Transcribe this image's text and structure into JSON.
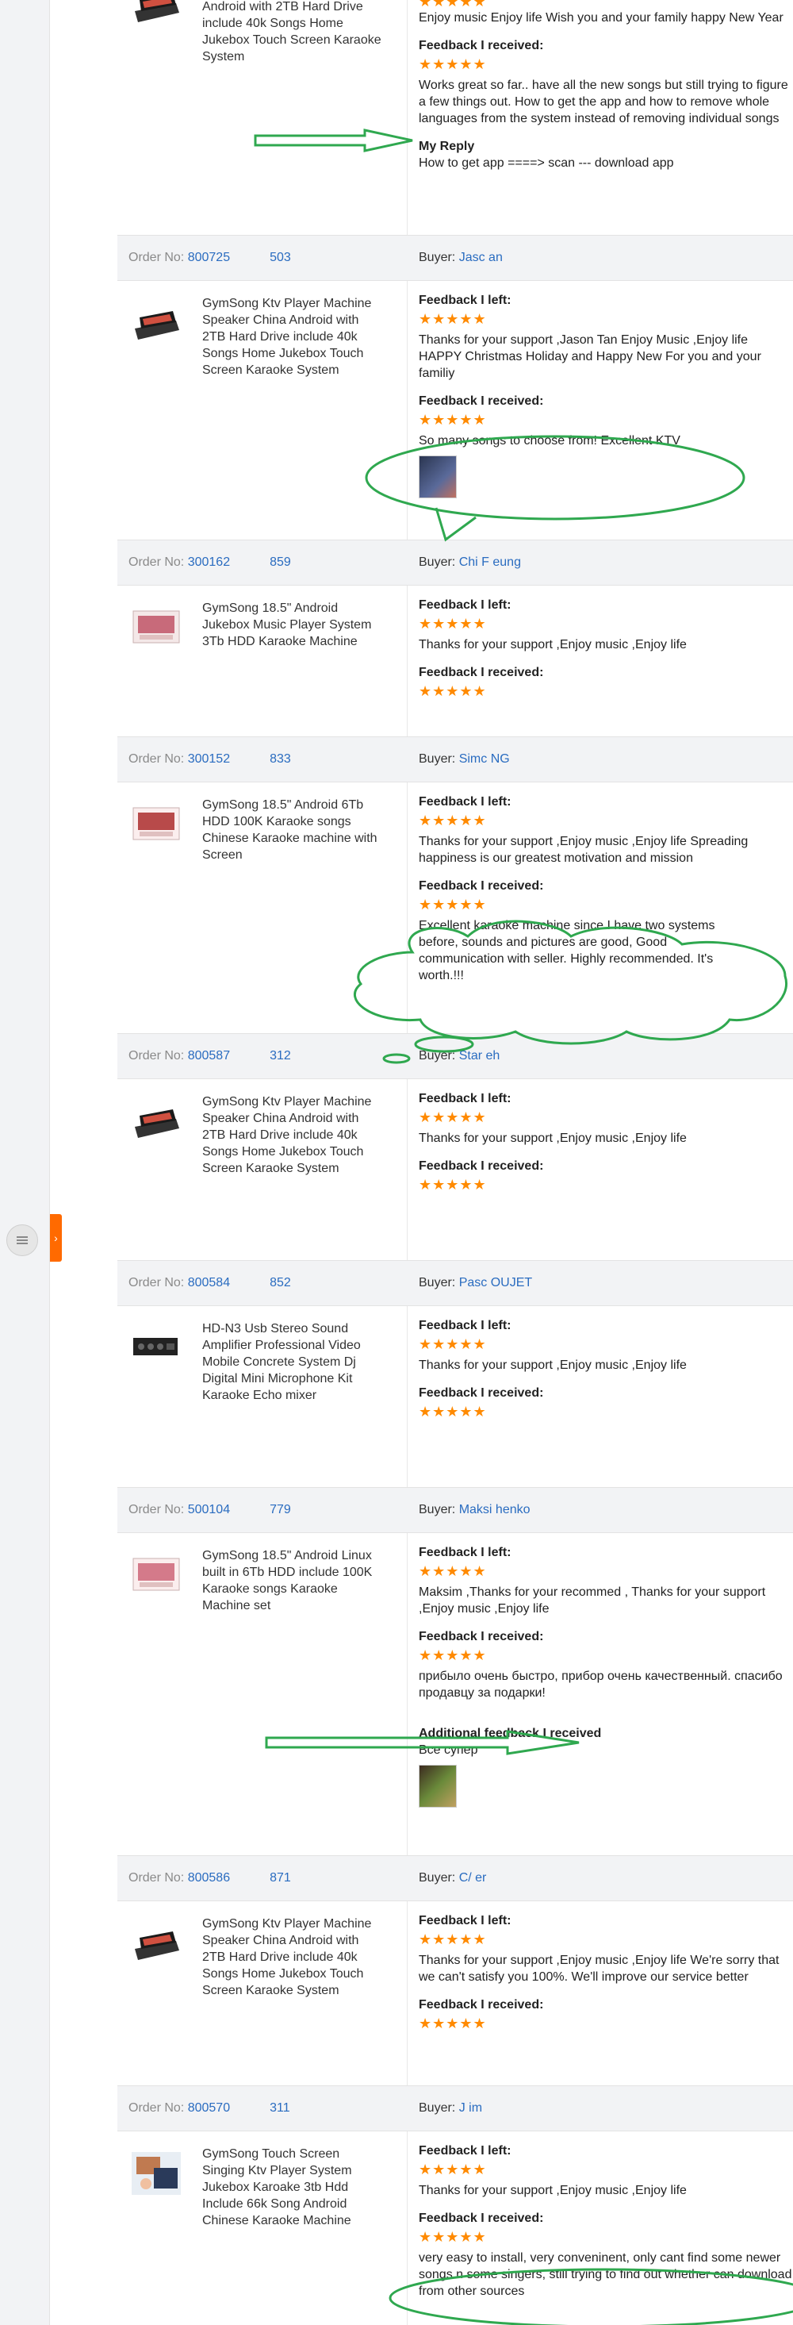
{
  "sidebar": {
    "menu_icon": "list-icon",
    "tab_icon": "chevron-right-icon",
    "tab_glyph": "›"
  },
  "top_partial": {
    "product_title": "Android with 2TB Hard Drive include 40k Songs Home Jukebox Touch Screen Karaoke System",
    "left_text": "Enjoy music Enjoy life Wish you and your family happy New Year",
    "received_label": "Feedback I received:",
    "received_text": "Works great so far.. have all the new songs but still trying to figure a few things out. How to get the app and how to remove whole languages from the system instead of removing individual songs",
    "reply_label": "My Reply",
    "reply_text": "How to get app ====> scan --- download app"
  },
  "labels": {
    "order_no": "Order No:",
    "buyer": "Buyer:",
    "left": "Feedback I left:",
    "received": "Feedback I received:",
    "additional": "Additional feedback I received"
  },
  "stars": "★★★★★",
  "orders": [
    {
      "order_no_a": "800725",
      "order_no_b": "503",
      "buyer": "Jasc        an",
      "product": "GymSong Ktv Player Machine Speaker China Android with 2TB Hard Drive include 40k Songs Home Jukebox Touch Screen Karaoke System",
      "left_text": "Thanks for your support ,Jason Tan Enjoy Music ,Enjoy life HAPPY Christmas Holiday and Happy New For you and your familiy",
      "received_text": "So many songs to choose from! Excellent KTV"
    },
    {
      "order_no_a": "300162",
      "order_no_b": "859",
      "buyer": "Chi F        eung",
      "product": "GymSong 18.5\" Android Jukebox Music Player System 3Tb HDD Karaoke Machine",
      "left_text": "Thanks for your support ,Enjoy music ,Enjoy life",
      "received_text": ""
    },
    {
      "order_no_a": "300152",
      "order_no_b": "833",
      "buyer": "Simc        NG",
      "product": "GymSong 18.5\" Android 6Tb HDD 100K Karaoke songs Chinese Karaoke machine with Screen",
      "left_text": "Thanks for your support ,Enjoy music ,Enjoy life Spreading happiness is our greatest motivation and mission",
      "received_text": "Excellent karaoke machine since I have two systems before, sounds and pictures are good, Good communication with seller. Highly recommended. It's worth.!!!"
    },
    {
      "order_no_a": "800587",
      "order_no_b": "312",
      "buyer": "Star        eh",
      "product": "GymSong Ktv Player Machine Speaker China Android with 2TB Hard Drive include 40k Songs Home Jukebox Touch Screen Karaoke System",
      "left_text": "Thanks for your support ,Enjoy music ,Enjoy life",
      "received_text": ""
    },
    {
      "order_no_a": "800584",
      "order_no_b": "852",
      "buyer": "Pasc        OUJET",
      "product": "HD-N3 Usb Stereo Sound Amplifier Professional Video Mobile Concrete System Dj Digital Mini Microphone Kit Karaoke Echo mixer",
      "left_text": "Thanks for your support ,Enjoy music ,Enjoy life",
      "received_text": ""
    },
    {
      "order_no_a": "500104",
      "order_no_b": "779",
      "buyer": "Maksi        henko",
      "product": "GymSong 18.5\" Android Linux built in 6Tb HDD include 100K Karaoke songs Karaoke Machine set",
      "left_text": "Maksim ,Thanks for your recommed , Thanks for your support ,Enjoy music ,Enjoy life",
      "received_text": "прибыло очень быстро, прибор очень качественный. спасибо продавцу за подарки!",
      "additional_text": "Все супер"
    },
    {
      "order_no_a": "800586",
      "order_no_b": "871",
      "buyer": "C/        er",
      "product": "GymSong Ktv Player Machine Speaker China Android with 2TB Hard Drive include 40k Songs Home Jukebox Touch Screen Karaoke System",
      "left_text": "Thanks for your support ,Enjoy music ,Enjoy life We're sorry that we can't satisfy you 100%. We'll improve our service better",
      "received_text": ""
    },
    {
      "order_no_a": "800570",
      "order_no_b": "311",
      "buyer": "J        im",
      "product": "GymSong Touch Screen Singing Ktv Player System Jukebox Karoake 3tb Hdd Include 66k Song Android Chinese Karaoke Machine",
      "left_text": "Thanks for your support ,Enjoy music ,Enjoy life",
      "received_text": "very easy to install, very conveninent, only cant find some newer songs n some singers, still trying to find out whether can download from other sources"
    }
  ],
  "colors": {
    "accent": "#ff6a00",
    "link": "#2a6cc0",
    "star": "#ff8a00",
    "annotation": "#2fa84f"
  }
}
